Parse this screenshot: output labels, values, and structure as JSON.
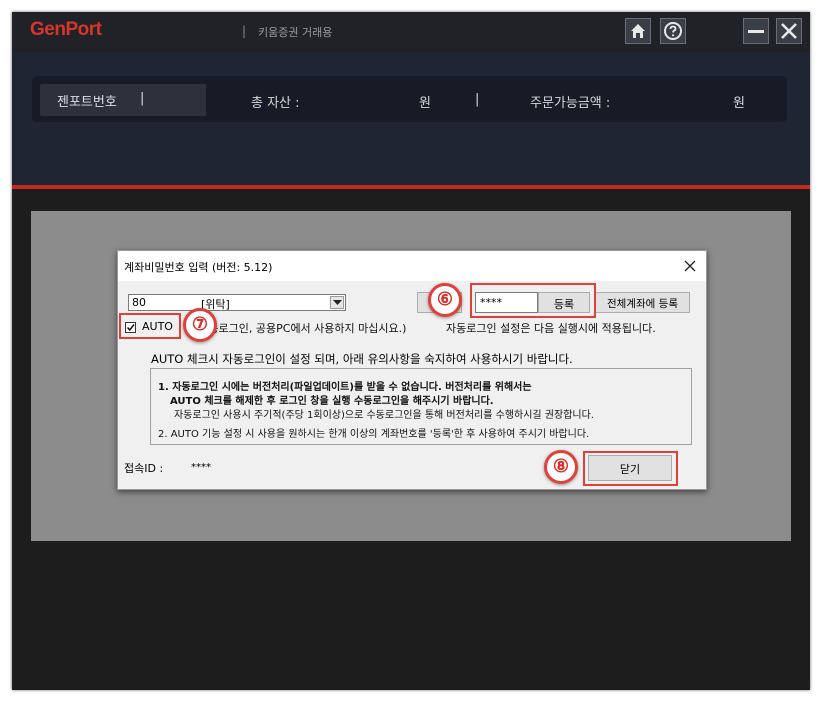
{
  "app": {
    "logo": "GenPort",
    "separator": "|",
    "broker_label": "키움증권 거래용"
  },
  "window_controls": {
    "home": "home-icon",
    "help": "help-icon",
    "minimize": "minimize-icon",
    "close": "close-icon"
  },
  "info_bar": {
    "genport_no_label": "젠포트번호",
    "tab_separator": "|",
    "total_assets_label": "총 자산 :",
    "total_assets_unit": "원",
    "divider": "|",
    "available_amount_label": "주문가능금액 :",
    "available_amount_unit": "원"
  },
  "dialog": {
    "title": "계좌비밀번호 입력 (버전: 5.12)",
    "account_select": {
      "number": "80",
      "type": "[위탁]"
    },
    "password_mask": "****",
    "register_button": "등록",
    "register_all_button": "전체계좌에 등록",
    "auto_checkbox_checked": true,
    "auto_label": "AUTO",
    "auto_note": "(자동로그인, 공용PC에서 사용하지 마십시요.)",
    "auto_note_suffix": "자동로그인 설정은 다음 실행시에 적용됩니다.",
    "notice_heading": "AUTO 체크시 자동로그인이 설정 되며, 아래 유의사항을 숙지하여 사용하시기 바랍니다.",
    "notice_lines": [
      "1. 자동로그인 시에는 버전처리(파일업데이트)를 받을 수 없습니다. 버전처리를 위해서는",
      "AUTO 체크를 해제한 후 로그인 창을 실행 수동로그인을 해주시기 바랍니다.",
      "자동로그인 사용시 주기적(주당 1회이상)으로 수동로그인을 통해 버전처리를 수행하시길 권장합니다.",
      "2. AUTO 기능 설정 시 사용을 원하시는 한개 이상의 계좌번호를 '등록'한 후 사용하여 주시기 바랍니다."
    ],
    "connection_id_label": "접속ID :",
    "connection_id_value": "****",
    "close_button": "닫기"
  },
  "annotations": {
    "badge_6": "⑥",
    "badge_7": "⑦",
    "badge_8": "⑧",
    "highlight_color": "#e0403a"
  }
}
